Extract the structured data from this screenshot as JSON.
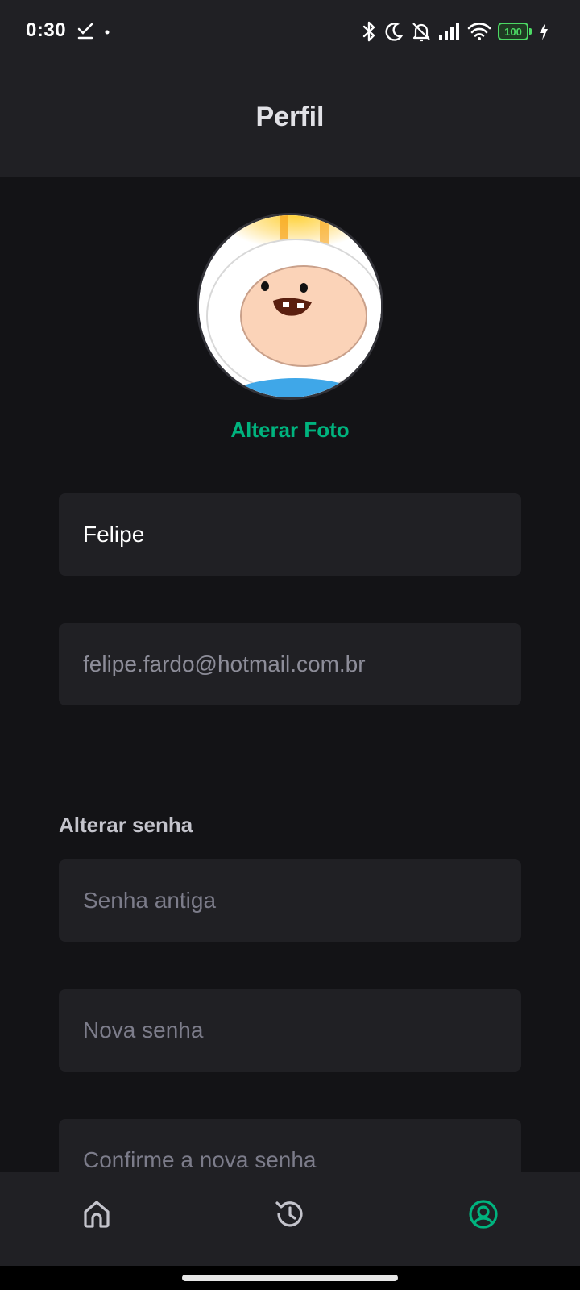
{
  "status_bar": {
    "time": "0:30",
    "battery_level": "100",
    "icons": [
      "download-done-icon",
      "dot-icon",
      "bluetooth-icon",
      "moon-icon",
      "bell-off-icon",
      "signal-icon",
      "wifi-icon",
      "battery-icon",
      "charging-icon"
    ]
  },
  "header": {
    "title": "Perfil"
  },
  "profile": {
    "change_photo_label": "Alterar Foto",
    "name_value": "Felipe",
    "email_value": "felipe.fardo@hotmail.com.br"
  },
  "password": {
    "section_label": "Alterar senha",
    "old_placeholder": "Senha antiga",
    "new_placeholder": "Nova senha",
    "confirm_placeholder": "Confirme a nova senha"
  },
  "bottom_nav": {
    "items": [
      {
        "icon": "home-icon",
        "active": false
      },
      {
        "icon": "history-icon",
        "active": false
      },
      {
        "icon": "user-circle-icon",
        "active": true
      }
    ]
  },
  "colors": {
    "accent": "#00b37e",
    "background": "#131316",
    "surface": "#202024",
    "text": "#e1e1e6",
    "placeholder": "#7c7c8a"
  }
}
